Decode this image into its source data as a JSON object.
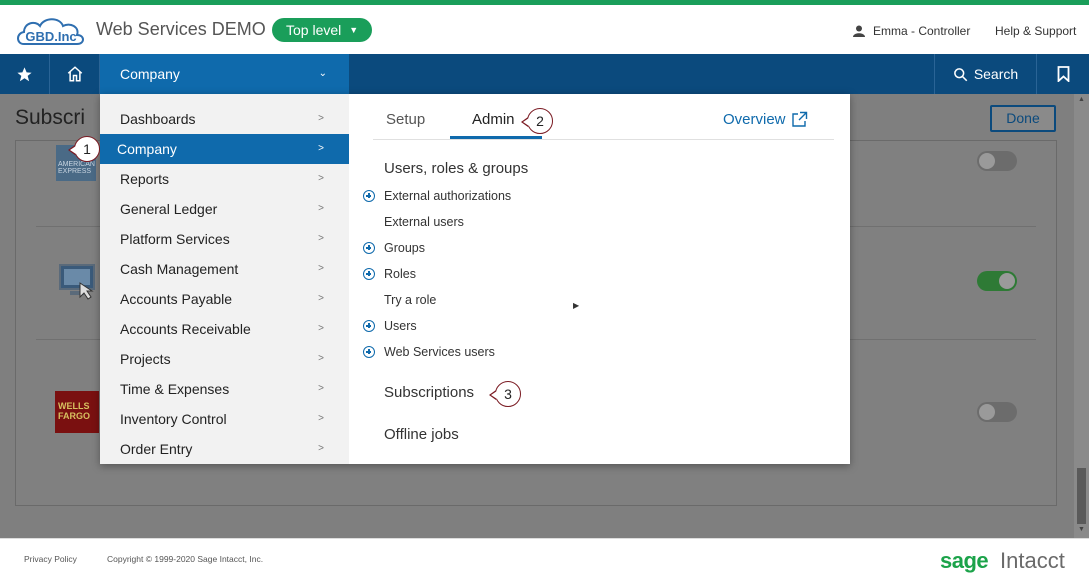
{
  "colors": {
    "brand_green": "#1a9e5a",
    "nav_blue": "#0b4a7d",
    "active_blue": "#0f6aac",
    "link_blue": "#0f6aac"
  },
  "header": {
    "logo_text": "GBD.Inc",
    "app_title": "Web Services DEMO",
    "level_button": "Top level",
    "user": "Emma - Controller",
    "help": "Help & Support"
  },
  "navbar": {
    "company": "Company",
    "search": "Search"
  },
  "page": {
    "title": "Subscri",
    "done": "Done",
    "amex_text": "AMERICAN EXPRESS",
    "wells_text": "WELLS FARGO",
    "toggles": [
      false,
      true,
      false
    ]
  },
  "menu": {
    "items": [
      "Dashboards",
      "Company",
      "Reports",
      "General Ledger",
      "Platform Services",
      "Cash Management",
      "Accounts Payable",
      "Accounts Receivable",
      "Projects",
      "Time & Expenses",
      "Inventory Control",
      "Order Entry"
    ],
    "active_index": 1
  },
  "submenu": {
    "tabs": [
      "Setup",
      "Admin"
    ],
    "active_tab": "Admin",
    "overview": "Overview",
    "section1": "Users, roles & groups",
    "links": [
      {
        "label": "External authorizations",
        "add": true
      },
      {
        "label": "External users",
        "add": false
      },
      {
        "label": "Groups",
        "add": true
      },
      {
        "label": "Roles",
        "add": true
      },
      {
        "label": "Try a role",
        "add": false,
        "submenu": true
      },
      {
        "label": "Users",
        "add": true
      },
      {
        "label": "Web Services users",
        "add": true
      }
    ],
    "section2": "Subscriptions",
    "section3": "Offline jobs"
  },
  "callouts": [
    "1",
    "2",
    "3"
  ],
  "footer": {
    "privacy": "Privacy Policy",
    "copyright": "Copyright © 1999-2020 Sage Intacct, Inc.",
    "brand_sage": "sage",
    "brand_intacct": "Intacct"
  }
}
